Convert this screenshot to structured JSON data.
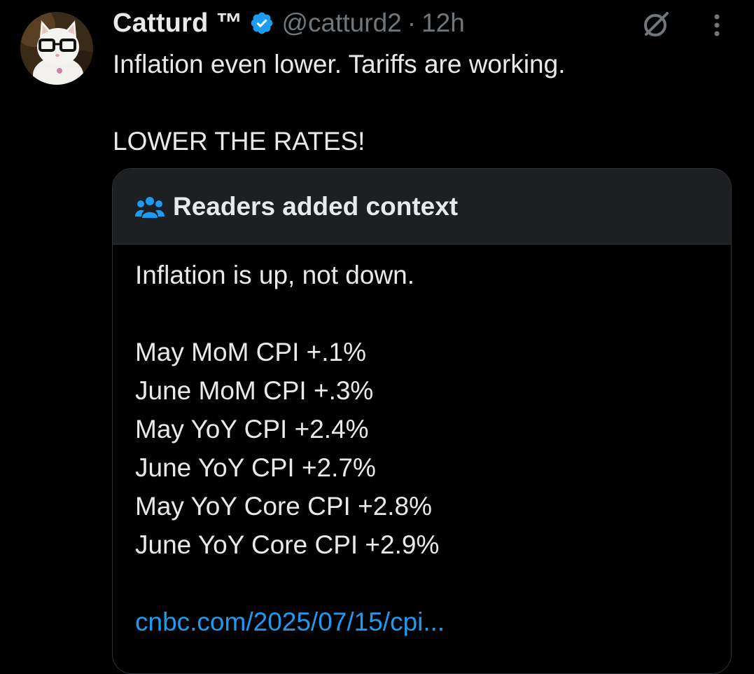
{
  "tweet": {
    "display_name": "Catturd ™",
    "handle": "@catturd2",
    "separator": "·",
    "time": "12h",
    "text_lines": [
      "Inflation even lower. Tariffs are working.",
      "",
      "LOWER THE RATES!"
    ],
    "icons": {
      "verified": "verified-badge-icon",
      "grok": "grok-icon",
      "more": "more-icon"
    }
  },
  "community_note": {
    "title": "Readers added context",
    "icon": "people-icon",
    "lines": [
      "Inflation is up, not down.",
      "",
      "May MoM CPI +.1%",
      "June MoM CPI +.3%",
      "May YoY CPI +2.4%",
      "June YoY CPI +2.7%",
      "May YoY Core CPI +2.8%",
      "June YoY Core CPI +2.9%",
      ""
    ],
    "link": "cnbc.com/2025/07/15/cpi..."
  },
  "colors": {
    "background": "#000000",
    "text": "#e7e9ea",
    "secondary_text": "#71767b",
    "accent": "#1d9bf0",
    "note_header_bg": "#1d1f23",
    "border": "#2f3336"
  }
}
